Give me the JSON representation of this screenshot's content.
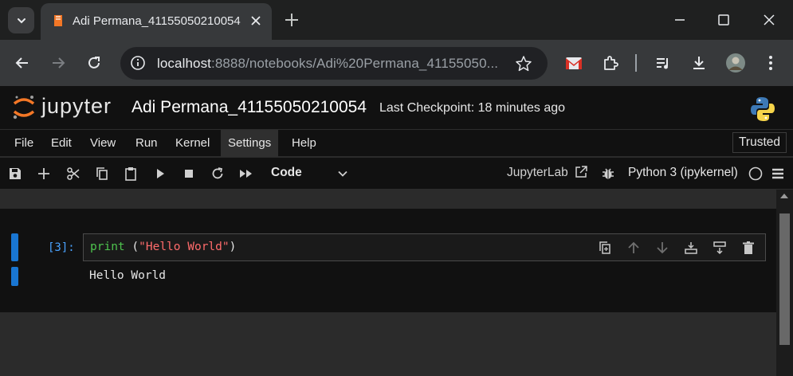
{
  "browser": {
    "tab": {
      "title": "Adi Permana_41155050210054"
    },
    "address": {
      "host": "localhost",
      "rest": ":8888/notebooks/Adi%20Permana_41155050..."
    }
  },
  "jupyter": {
    "logo_text": "jupyter",
    "notebook_title": "Adi Permana_41155050210054",
    "checkpoint": "Last Checkpoint: 18 minutes ago",
    "menu": [
      "File",
      "Edit",
      "View",
      "Run",
      "Kernel",
      "Settings",
      "Help"
    ],
    "trusted": "Trusted",
    "toolbar": {
      "cell_type": "Code",
      "jupyterlab_link": "JupyterLab",
      "kernel": "Python 3 (ipykernel)"
    }
  },
  "cell": {
    "prompt": "[3]:",
    "code_keyword": "print",
    "code_space": " (",
    "code_string": "\"Hello World\"",
    "code_close": ")",
    "output": "Hello World"
  },
  "colors": {
    "accent": "#1976d2",
    "keyword": "#4ec34e",
    "string": "#ff6b6b",
    "prompt": "#4aa3ff"
  }
}
